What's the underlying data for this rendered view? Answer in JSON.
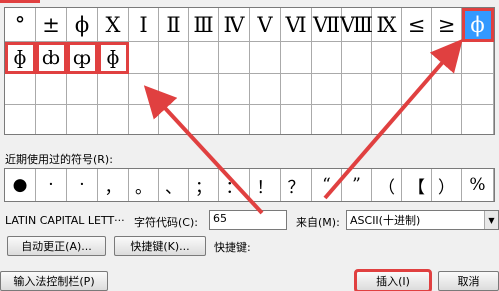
{
  "symbols_row1": [
    "°",
    "±",
    "ϕ",
    "Ⅹ",
    "Ⅰ",
    "Ⅱ",
    "Ⅲ",
    "Ⅳ",
    "Ⅴ",
    "Ⅵ",
    "Ⅶ",
    "Ⅷ",
    "Ⅸ",
    "≤",
    "≥",
    "ϕ"
  ],
  "symbols_row2": [
    "ɸ",
    "ȸ",
    "ȹ",
    "ɸ"
  ],
  "recent_label": "近期使用过的符号(R):",
  "recent_symbols": [
    "●",
    "·",
    "·",
    "，",
    "。",
    "、",
    "；",
    "：",
    "！",
    "？",
    "“",
    "”",
    "（",
    "【",
    "）",
    "%"
  ],
  "char_name": "LATIN CAPITAL LETT···",
  "char_code_label": "字符代码(C):",
  "char_code_value": "65",
  "from_label": "来自(M):",
  "from_value": "ASCII(十进制)",
  "autocorrect_button": "自动更正(A)...",
  "shortcut_button": "快捷键(K)...",
  "shortcut_label": "快捷键:",
  "ime_button": "输入法控制栏(P)",
  "insert_button": "插入(I)",
  "cancel_button": "取消",
  "colors": {
    "annotation": "#e04040",
    "selection": "#3399ff"
  }
}
